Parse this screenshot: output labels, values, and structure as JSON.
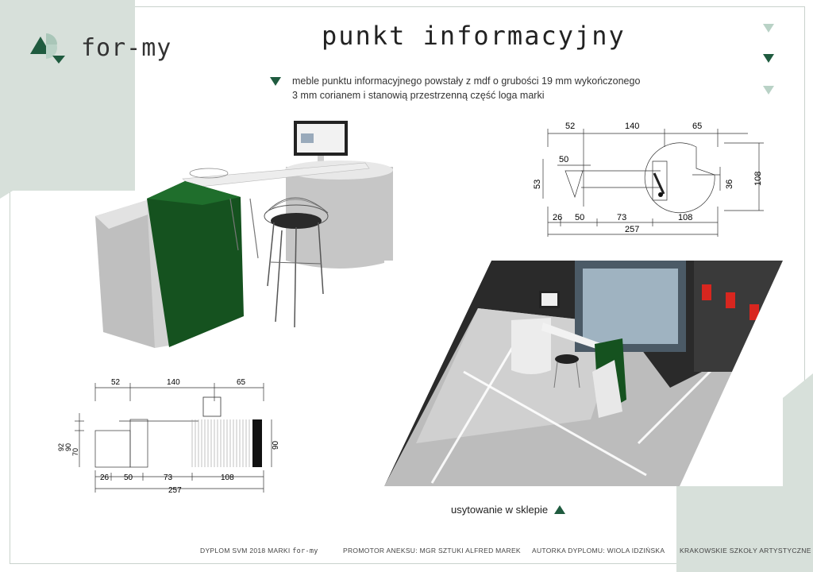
{
  "brand": {
    "logo_text": "for-my"
  },
  "title": "punkt informacyjny",
  "description": {
    "line1": "meble punktu informacyjnego powstały z mdf o grubości 19 mm wykończonego",
    "line2": "3 mm corianem  i stanowią przestrzenną część loga marki"
  },
  "top_drawing": {
    "dims_top": [
      "52",
      "140",
      "65"
    ],
    "dims_mid": [
      "50"
    ],
    "dims_left": "53",
    "dims_right": [
      "36",
      "108"
    ],
    "dims_bottom": [
      "26",
      "50",
      "73",
      "108"
    ],
    "total": "257"
  },
  "front_drawing": {
    "dims_top": [
      "52",
      "140",
      "65"
    ],
    "dims_left": [
      "92",
      "90",
      "70"
    ],
    "dims_right": "90",
    "dims_bottom": [
      "26",
      "50",
      "73",
      "108"
    ],
    "total": "257"
  },
  "caption": "usytowanie w sklepie",
  "footer": {
    "diploma_prefix": "DYPLOM SVM 2018 MARKI",
    "diploma_brand": "for-my",
    "promotor": "PROMOTOR ANEKSU: MGR SZTUKI ALFRED MAREK",
    "author": "AUTORKA DYPLOMU: WIOLA IDZIŃSKA",
    "school": "KRAKOWSKIE SZKOŁY ARTYSTYCZNE"
  },
  "colors": {
    "accent": "#1f5b3f",
    "mint": "#d7e0da",
    "furniture_green": "#15521f"
  },
  "icons": [
    "logo-mark-icon",
    "triangle-down-icon",
    "triangle-up-icon"
  ]
}
